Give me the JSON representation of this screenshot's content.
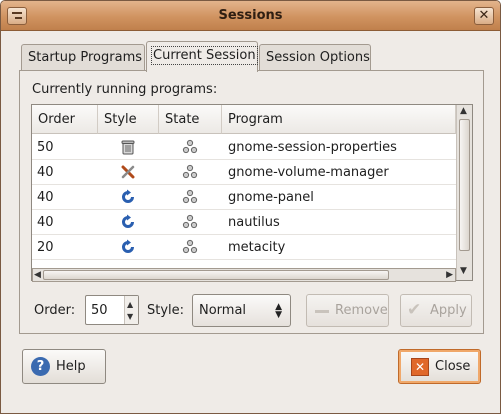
{
  "window": {
    "title": "Sessions"
  },
  "tabs": [
    {
      "label": "Startup Programs",
      "active": false
    },
    {
      "label": "Current Session",
      "active": true
    },
    {
      "label": "Session Options",
      "active": false
    }
  ],
  "panel": {
    "label": "Currently running programs:",
    "columns": [
      "Order",
      "Style",
      "State",
      "Program"
    ],
    "rows": [
      {
        "order": "50",
        "style_icon": "trash-icon",
        "state_icon": "session-state-icon",
        "program": "gnome-session-properties"
      },
      {
        "order": "40",
        "style_icon": "tools-icon",
        "state_icon": "session-state-icon",
        "program": "gnome-volume-manager"
      },
      {
        "order": "40",
        "style_icon": "restart-icon",
        "state_icon": "session-state-icon",
        "program": "gnome-panel"
      },
      {
        "order": "40",
        "style_icon": "restart-icon",
        "state_icon": "session-state-icon",
        "program": "nautilus"
      },
      {
        "order": "20",
        "style_icon": "restart-icon",
        "state_icon": "session-state-icon",
        "program": "metacity"
      }
    ],
    "order_label": "Order:",
    "order_value": "50",
    "style_label": "Style:",
    "style_value": "Normal",
    "remove_label": "Remove",
    "apply_label": "Apply"
  },
  "footer": {
    "help_label": "Help",
    "close_label": "Close"
  },
  "colors": {
    "titlebar": "#d09360",
    "close_accent": "#e0682a",
    "help_accent": "#3a6ab0"
  }
}
